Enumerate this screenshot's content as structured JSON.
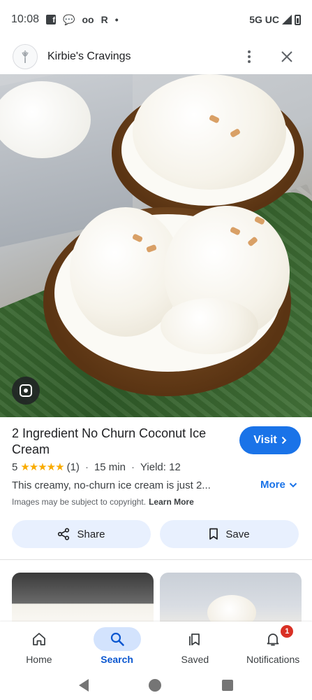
{
  "status_bar": {
    "time": "10:08",
    "network": "5G UC",
    "notification_icons": [
      "facebook-icon",
      "chat-icon",
      "voicemail-icon",
      "r-app-icon",
      "dot-icon"
    ]
  },
  "header": {
    "site_name": "Kirbie's Cravings"
  },
  "result": {
    "title": "2 Ingredient No Churn Coconut Ice Cream",
    "visit_label": "Visit",
    "rating_value": "5",
    "stars": "★★★★★",
    "rating_count": "(1)",
    "time": "15 min",
    "yield": "Yield: 12",
    "description": "This creamy, no-churn ice cream is just 2...",
    "more_label": "More",
    "copyright_text": "Images may be subject to copyright.",
    "learn_more_label": "Learn More",
    "share_label": "Share",
    "save_label": "Save"
  },
  "bottom_nav": {
    "items": [
      {
        "label": "Home",
        "icon": "home-icon",
        "active": false
      },
      {
        "label": "Search",
        "icon": "search-icon",
        "active": true
      },
      {
        "label": "Saved",
        "icon": "bookmarks-icon",
        "active": false
      },
      {
        "label": "Notifications",
        "icon": "bell-icon",
        "active": false,
        "badge": "1"
      }
    ]
  },
  "colors": {
    "accent_blue": "#1a73e8",
    "tonal_button": "#e8f0fe",
    "star_yellow": "#f9ab00",
    "badge_red": "#d93025"
  }
}
